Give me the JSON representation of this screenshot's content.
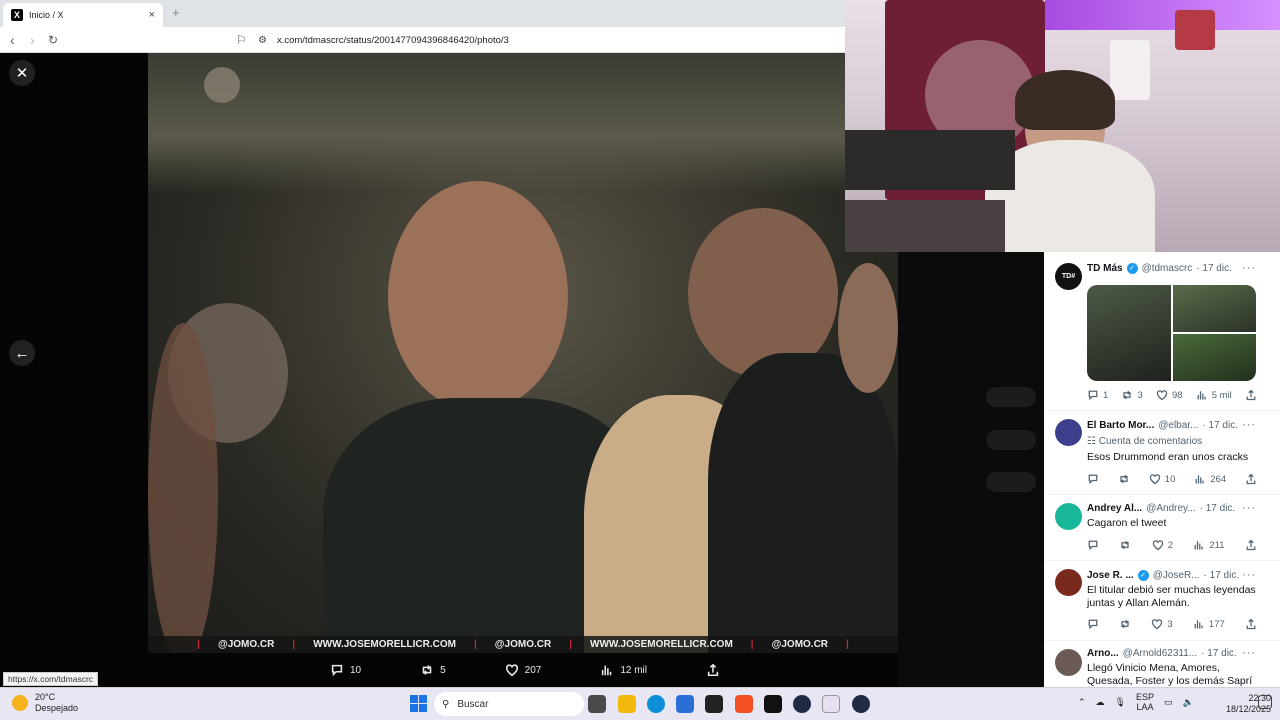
{
  "browser": {
    "tab_title": "Inicio / X",
    "tab_close": "×",
    "new_tab": "+",
    "url": "x.com/tdmascrc/status/2001477094396846420/photo/3",
    "status_url": "https://x.com/tdmascrc"
  },
  "viewer": {
    "close": "✕",
    "prev": "←",
    "next": "→",
    "watermark": [
      "@JOMO.CR",
      "WWW.JOSEMORELLICR.COM",
      "@JOMO.CR",
      "WWW.JOSEMORELLICR.COM",
      "@JOMO.CR"
    ],
    "separator": "|",
    "actions": {
      "replies": "10",
      "reposts": "5",
      "likes": "207",
      "views": "12 mil"
    }
  },
  "replies": [
    {
      "name": "TD Más",
      "handle": "@tdmascrc",
      "date": "· 17 dic.",
      "verified": true,
      "avatar_text": "TD#",
      "avatar_color": "#111111",
      "replies": "1",
      "reposts": "3",
      "likes": "98",
      "views": "5 mil"
    },
    {
      "name": "El Barto Mor...",
      "handle": "@elbar...",
      "date": "· 17 dic.",
      "label": "Cuenta de comentarios",
      "text": "Esos Drummond eran unos cracks",
      "avatar_color": "#3b3f8c",
      "replies": "",
      "reposts": "",
      "likes": "10",
      "views": "264"
    },
    {
      "name": "Andrey Al...",
      "handle": "@Andrey...",
      "date": "· 17 dic.",
      "text": "Cagaron el tweet",
      "avatar_color": "#18b79a",
      "replies": "",
      "reposts": "",
      "likes": "2",
      "views": "211"
    },
    {
      "name": "Jose R. ...",
      "handle": "@JoseR...",
      "date": "· 17 dic.",
      "verified": true,
      "text": "El titular debió ser muchas leyendas juntas y Allan Alemán.",
      "avatar_color": "#7a2a1c",
      "replies": "",
      "reposts": "",
      "likes": "3",
      "views": "177"
    },
    {
      "name": "Arno...",
      "handle": "@Arnold62311...",
      "date": "· 17 dic.",
      "text": "Llegó Vinicio Mena, Amores, Quesada, Foster y los demás Saprí",
      "avatar_color": "#6b5a55"
    }
  ],
  "taskbar": {
    "temp": "20°C",
    "weather": "Despejado",
    "search_placeholder": "Buscar",
    "lang1": "ESP",
    "lang2": "LAA",
    "time": "22:30",
    "date": "18/12/2025"
  }
}
